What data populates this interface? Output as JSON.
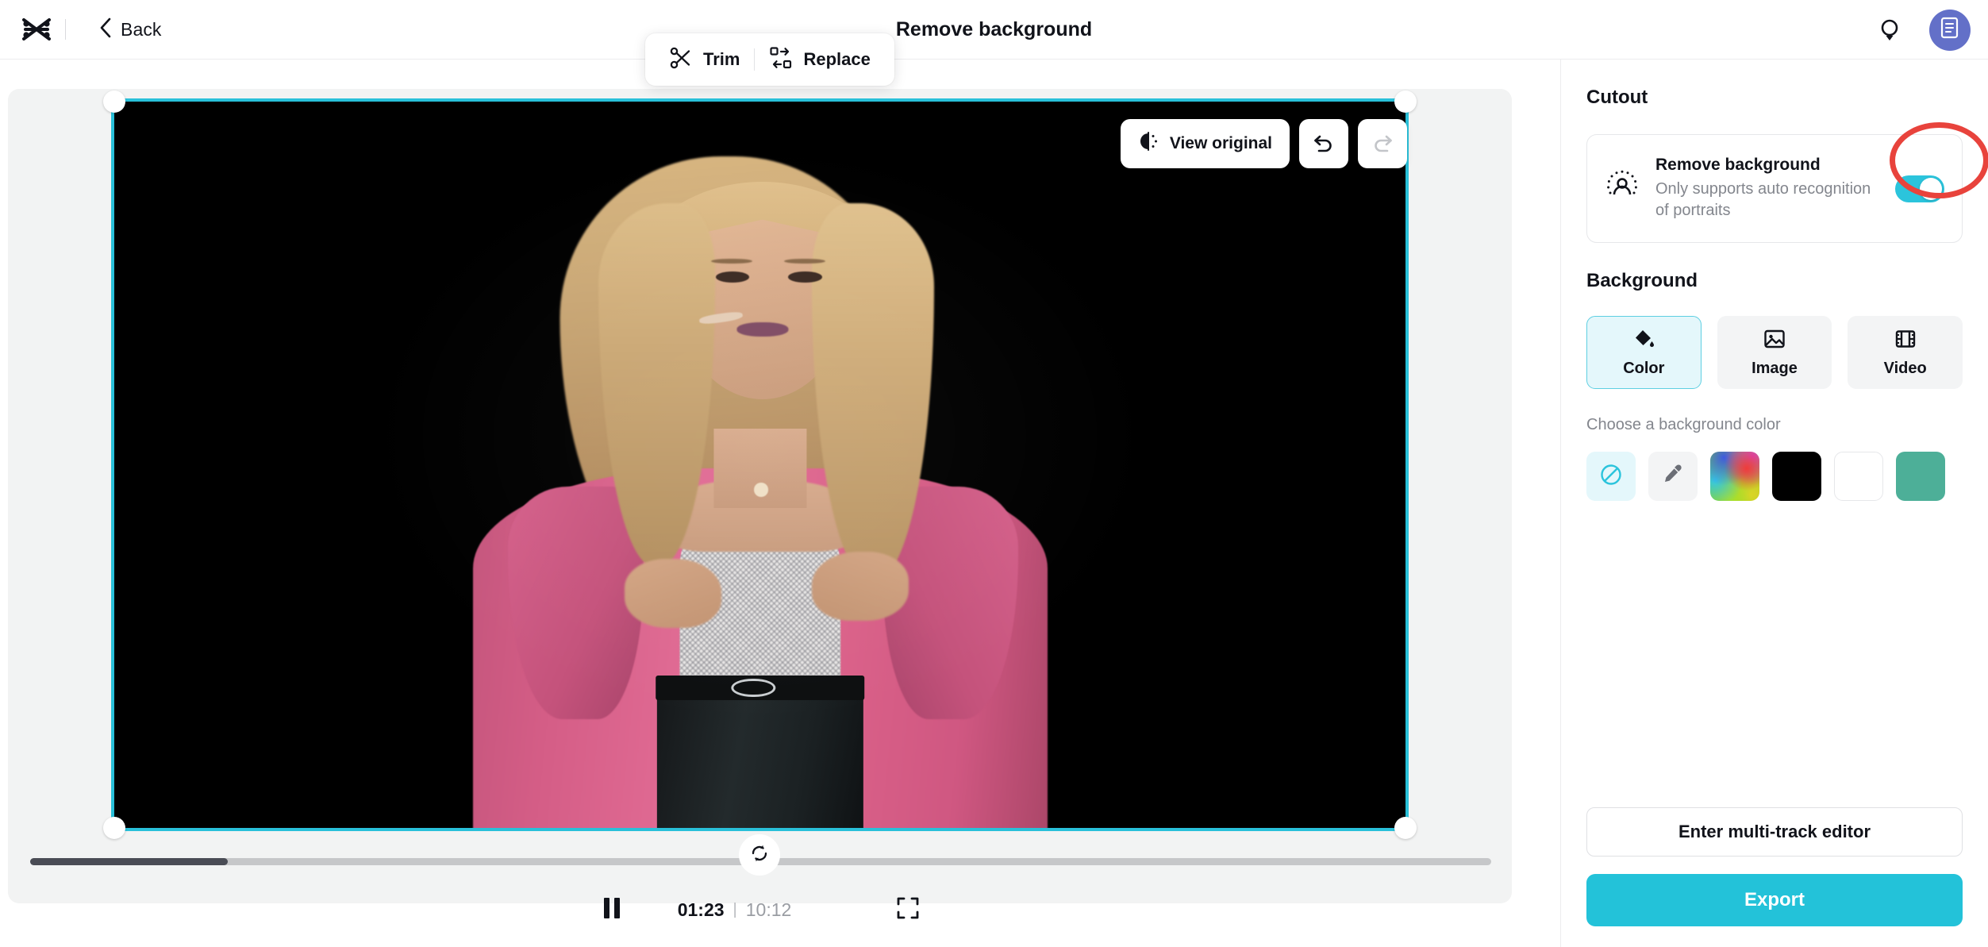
{
  "header": {
    "logo_icon": "capcut-logo-icon",
    "back_label": "Back",
    "title": "Remove background",
    "bulb_icon": "lightbulb-icon",
    "avatar_icon": "document-avatar-icon"
  },
  "float_toolbar": {
    "trim_label": "Trim",
    "trim_icon": "scissors-icon",
    "replace_label": "Replace",
    "replace_icon": "replace-icon"
  },
  "preview": {
    "view_original_label": "View original",
    "view_original_icon": "compare-contrast-icon",
    "undo_icon": "undo-arrow-icon",
    "redo_icon": "redo-arrow-icon",
    "selection_border_color": "#29C0D9",
    "canvas_background": "#000000"
  },
  "playback": {
    "play_state_icon": "pause-icon",
    "current_time": "01:23",
    "separator": "|",
    "total_time": "10:12",
    "fullscreen_icon": "fullscreen-icon",
    "loop_icon": "loop-icon",
    "progress_percent": 13.5
  },
  "panel": {
    "cutout": {
      "section_title": "Cutout",
      "icon": "portrait-cutout-icon",
      "title": "Remove background",
      "subtitle": "Only supports auto recognition of portraits",
      "toggle_on": true,
      "toggle_color": "#2BC4DC",
      "annotation_color": "#E8433C"
    },
    "background": {
      "section_title": "Background",
      "tabs": [
        {
          "label": "Color",
          "icon": "paint-bucket-icon",
          "active": true
        },
        {
          "label": "Image",
          "icon": "image-icon",
          "active": false
        },
        {
          "label": "Video",
          "icon": "film-strip-icon",
          "active": false
        }
      ],
      "choose_label": "Choose a background color",
      "swatches": [
        {
          "name": "none",
          "icon": "no-color-icon",
          "color": "#E4F7FB",
          "selected": true
        },
        {
          "name": "eyedropper",
          "icon": "eyedropper-icon",
          "color": "#F3F4F5",
          "selected": false
        },
        {
          "name": "color-picker",
          "icon": "rainbow-gradient-icon",
          "color": "rainbow",
          "selected": false
        },
        {
          "name": "black",
          "icon": "",
          "color": "#000000",
          "selected": false
        },
        {
          "name": "white",
          "icon": "",
          "color": "#FFFFFF",
          "selected": false
        },
        {
          "name": "teal",
          "icon": "",
          "color": "#4DAF98",
          "selected": false
        }
      ]
    },
    "actions": {
      "multitrack_label": "Enter multi-track editor",
      "export_label": "Export",
      "export_color": "#23C2D9"
    }
  }
}
